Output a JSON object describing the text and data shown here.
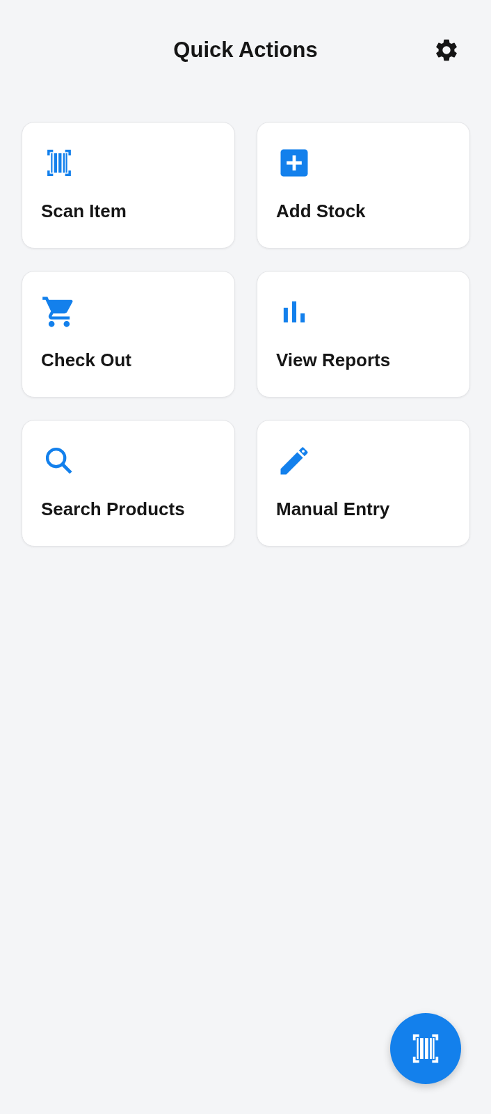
{
  "header": {
    "title": "Quick Actions"
  },
  "actions": [
    {
      "kind": "scan",
      "label": "Scan Item"
    },
    {
      "kind": "add",
      "label": "Add Stock"
    },
    {
      "kind": "cart",
      "label": "Check Out"
    },
    {
      "kind": "chart",
      "label": "View Reports"
    },
    {
      "kind": "search",
      "label": "Search Products"
    },
    {
      "kind": "pencil",
      "label": "Manual Entry"
    }
  ],
  "fab": {
    "kind": "scan"
  }
}
